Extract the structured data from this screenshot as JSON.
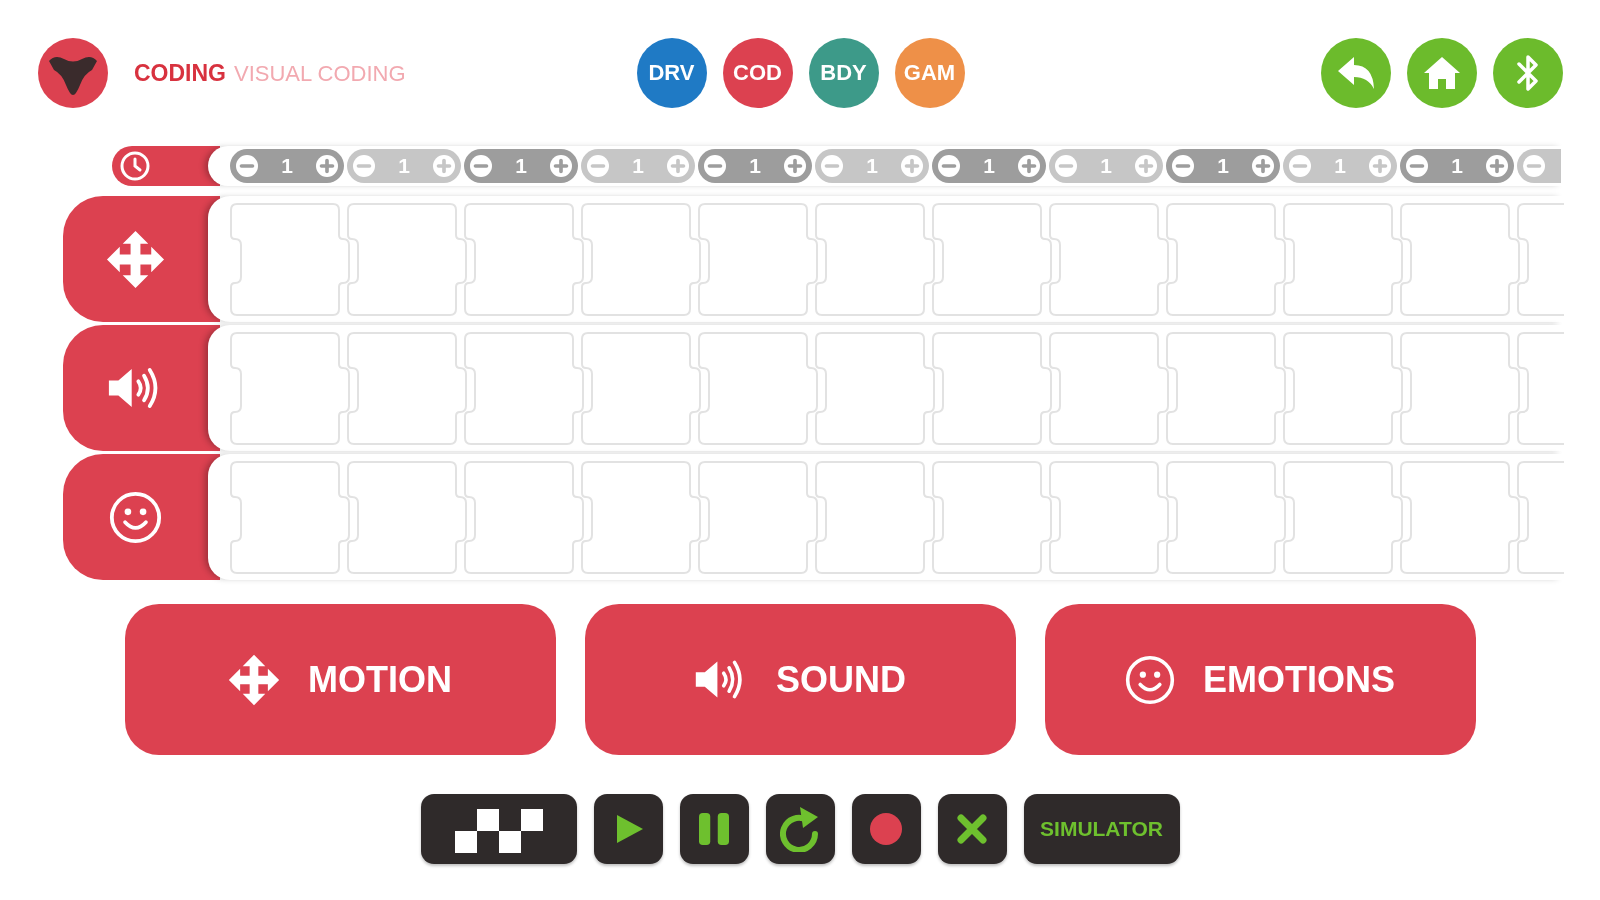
{
  "header": {
    "section": "CODING",
    "title": "VISUAL CODING"
  },
  "modes": [
    {
      "label": "DRV",
      "color": "#1f7ac5"
    },
    {
      "label": "COD",
      "color": "#dc4150"
    },
    {
      "label": "BDY",
      "color": "#3d9a89"
    },
    {
      "label": "GAM",
      "color": "#ee9048"
    }
  ],
  "nav": [
    {
      "kind": "back"
    },
    {
      "kind": "home"
    },
    {
      "kind": "bluetooth"
    }
  ],
  "timeline": {
    "steps": [
      {
        "value": "1"
      },
      {
        "value": "1"
      },
      {
        "value": "1"
      },
      {
        "value": "1"
      },
      {
        "value": "1"
      },
      {
        "value": "1"
      },
      {
        "value": "1"
      },
      {
        "value": "1"
      },
      {
        "value": "1"
      },
      {
        "value": "1"
      },
      {
        "value": "1"
      }
    ]
  },
  "tracks": [
    {
      "kind": "motion"
    },
    {
      "kind": "sound"
    },
    {
      "kind": "emotions"
    }
  ],
  "categories": [
    {
      "kind": "motion",
      "label": "MOTION"
    },
    {
      "kind": "sound",
      "label": "SOUND"
    },
    {
      "kind": "emotions",
      "label": "EMOTIONS"
    }
  ],
  "controls": [
    {
      "kind": "finish"
    },
    {
      "kind": "play"
    },
    {
      "kind": "pause"
    },
    {
      "kind": "restart"
    },
    {
      "kind": "record"
    },
    {
      "kind": "cancel"
    },
    {
      "kind": "simulator",
      "label": "SIMULATOR"
    }
  ]
}
